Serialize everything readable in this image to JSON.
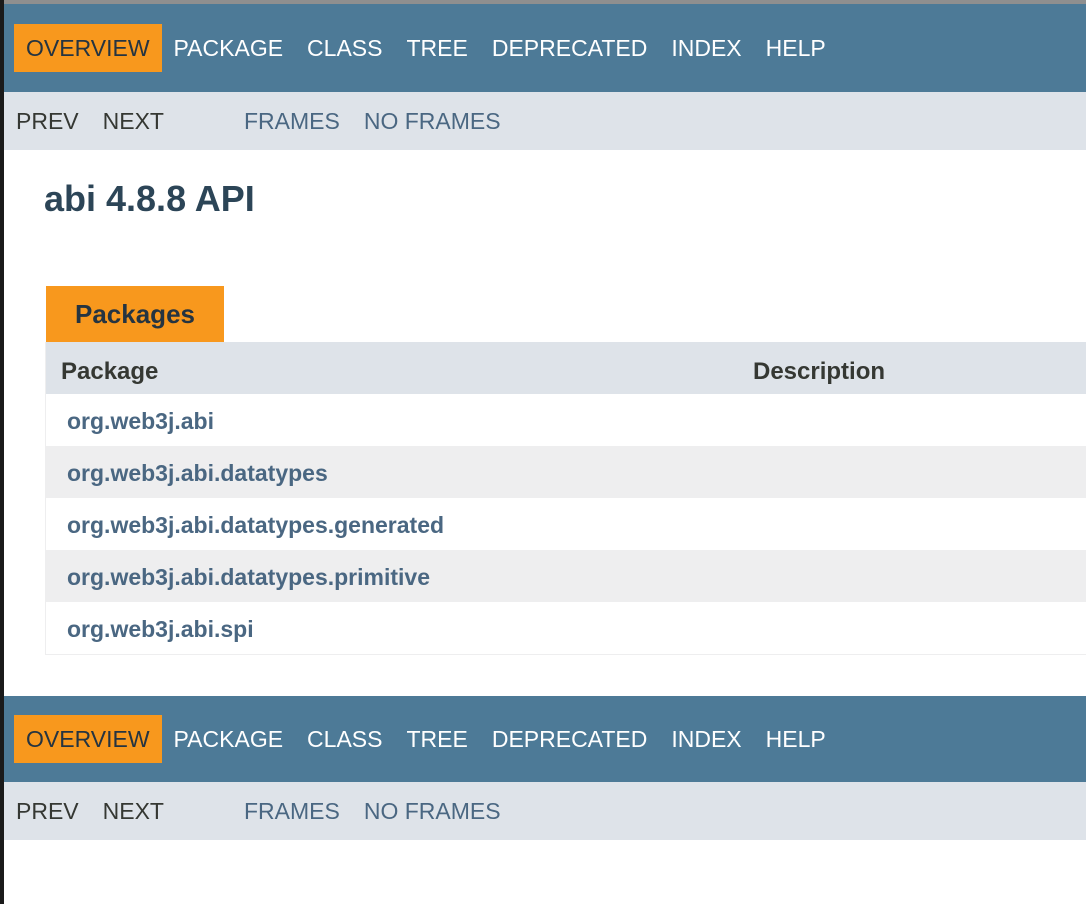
{
  "nav": {
    "items": [
      "OVERVIEW",
      "PACKAGE",
      "CLASS",
      "TREE",
      "DEPRECATED",
      "INDEX",
      "HELP"
    ],
    "active": "OVERVIEW"
  },
  "subnav": {
    "prev": "PREV",
    "next": "NEXT",
    "frames": "FRAMES",
    "no_frames": "NO FRAMES"
  },
  "page": {
    "title": "abi 4.8.8 API"
  },
  "packages": {
    "caption": "Packages",
    "headers": {
      "package": "Package",
      "description": "Description"
    },
    "rows": [
      "org.web3j.abi",
      "org.web3j.abi.datatypes",
      "org.web3j.abi.datatypes.generated",
      "org.web3j.abi.datatypes.primitive",
      "org.web3j.abi.spi"
    ]
  },
  "colors": {
    "nav_bg": "#4d7a97",
    "active_tab": "#f8981d",
    "subnav_bg": "#dee3e9",
    "link": "#4a6782"
  }
}
